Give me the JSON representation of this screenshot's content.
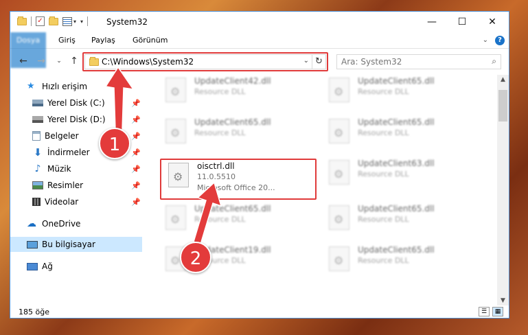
{
  "window": {
    "title": "System32",
    "buttons": {
      "minimize": "—",
      "maximize": "☐",
      "close": "✕"
    }
  },
  "ribbon": {
    "tabs": [
      "Dosya",
      "Giriş",
      "Paylaş",
      "Görünüm"
    ],
    "help": "?"
  },
  "nav": {
    "address": "C:\\Windows\\System32",
    "search_placeholder": "Ara: System32"
  },
  "sidebar": {
    "items": [
      {
        "label": "Hızlı erişim",
        "icon": "star-icon",
        "pinned": false
      },
      {
        "label": "Yerel Disk (C:)",
        "icon": "drive-icon",
        "pinned": true
      },
      {
        "label": "Yerel Disk (D:)",
        "icon": "drive-icon",
        "pinned": true
      },
      {
        "label": "Belgeler",
        "icon": "documents-icon",
        "pinned": true
      },
      {
        "label": "İndirmeler",
        "icon": "download-icon",
        "pinned": true
      },
      {
        "label": "Müzik",
        "icon": "music-icon",
        "pinned": true
      },
      {
        "label": "Resimler",
        "icon": "pictures-icon",
        "pinned": true
      },
      {
        "label": "Videolar",
        "icon": "videos-icon",
        "pinned": true
      },
      {
        "label": "OneDrive",
        "icon": "cloud-icon",
        "pinned": false
      },
      {
        "label": "Bu bilgisayar",
        "icon": "computer-icon",
        "pinned": false
      },
      {
        "label": "Ağ",
        "icon": "network-icon",
        "pinned": false
      }
    ]
  },
  "files": [
    {
      "name": "UpdateClient42.dll",
      "line2": "Resource DLL",
      "line3": ""
    },
    {
      "name": "UpdateClient65.dll",
      "line2": "Resource DLL",
      "line3": ""
    },
    {
      "name": "UpdateClient65.dll",
      "line2": "Resource DLL",
      "line3": ""
    },
    {
      "name": "UpdateClient65.dll",
      "line2": "Resource DLL",
      "line3": ""
    },
    {
      "name": "oisctrl.dll",
      "line2": "11.0.5510",
      "line3": "Microsoft Office 20..."
    },
    {
      "name": "UpdateClient63.dll",
      "line2": "Resource DLL",
      "line3": ""
    },
    {
      "name": "UpdateClient65.dll",
      "line2": "Resource DLL",
      "line3": ""
    },
    {
      "name": "UpdateClient65.dll",
      "line2": "Resource DLL",
      "line3": ""
    },
    {
      "name": "UpdateClient19.dll",
      "line2": "Resource DLL",
      "line3": ""
    },
    {
      "name": "UpdateClient65.dll",
      "line2": "Resource DLL",
      "line3": ""
    }
  ],
  "status": {
    "count": "185 öğe"
  },
  "annotations": {
    "step1": "1",
    "step2": "2"
  },
  "colors": {
    "accent": "#1979ca",
    "highlight": "#e03a3a",
    "selected": "#cce8ff"
  }
}
